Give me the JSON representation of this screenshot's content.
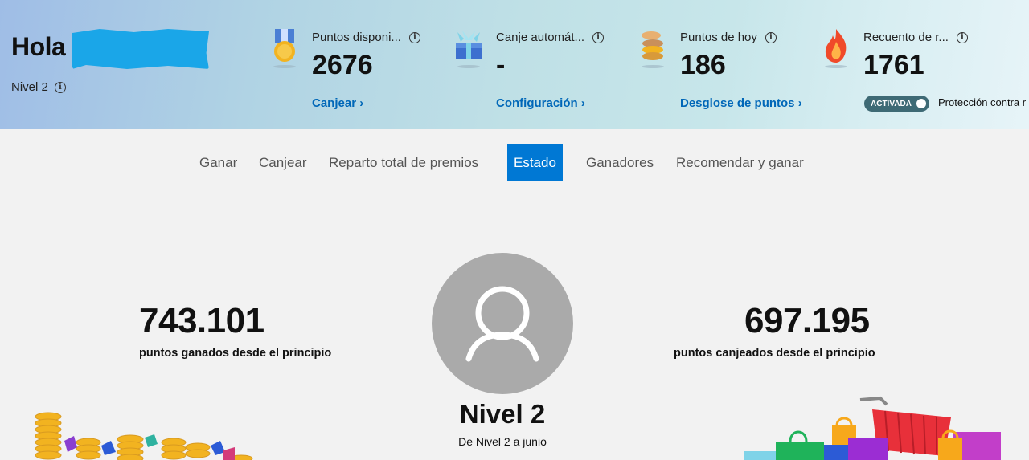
{
  "header": {
    "greeting": "Hola",
    "level": "Nivel 2",
    "stats": [
      {
        "label": "Puntos disponi...",
        "value": "2676",
        "link": "Canjear",
        "icon": "medal-icon"
      },
      {
        "label": "Canje automát...",
        "value": "-",
        "link": "Configuración",
        "icon": "gift-box-icon"
      },
      {
        "label": "Puntos de hoy",
        "value": "186",
        "link": "Desglose de puntos",
        "icon": "coin-stack-icon"
      },
      {
        "label": "Recuento de r...",
        "value": "1761",
        "toggle": "ACTIVADA",
        "toggle_label": "Protección contra r",
        "icon": "flame-icon"
      }
    ]
  },
  "tabs": [
    "Ganar",
    "Canjear",
    "Reparto total de premios",
    "Estado",
    "Ganadores",
    "Recomendar y ganar"
  ],
  "active_tab": "Estado",
  "status": {
    "earned_value": "743.101",
    "earned_label": "puntos ganados desde el principio",
    "redeemed_value": "697.195",
    "redeemed_label": "puntos canjeados desde el principio",
    "level_title": "Nivel 2",
    "level_subtitle": "De Nivel 2 a junio"
  },
  "colors": {
    "accent": "#0078d4",
    "link": "#0067b8",
    "toggle": "#3e6a75"
  }
}
